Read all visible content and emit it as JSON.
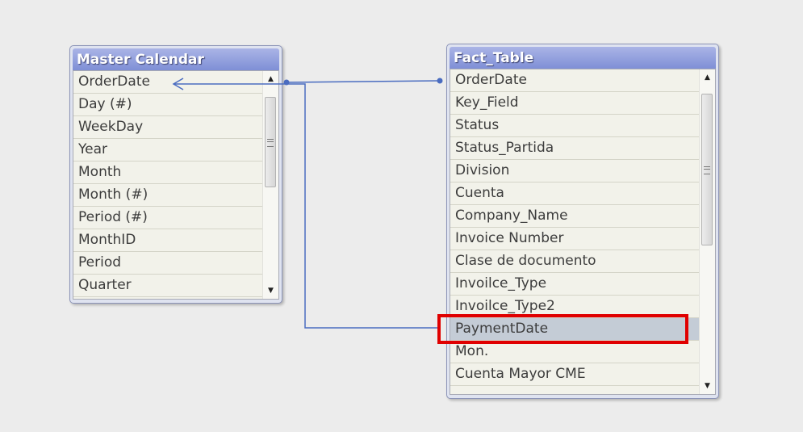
{
  "tables": [
    {
      "title": "Master Calendar",
      "fields": [
        "OrderDate",
        "Day (#)",
        "WeekDay",
        "Year",
        "Month",
        "Month (#)",
        "Period (#)",
        "MonthID",
        "Period",
        "Quarter"
      ],
      "scroll": {
        "up_icon": "scroll-up-arrow",
        "down_icon": "scroll-down-arrow"
      }
    },
    {
      "title": "Fact_Table",
      "fields": [
        "OrderDate",
        "Key_Field",
        "Status",
        "Status_Partida",
        "Division",
        "Cuenta",
        "Company_Name",
        "Invoice Number",
        "Clase de documento",
        "Invoilce_Type",
        "Invoilce_Type2",
        "PaymentDate",
        "Mon.",
        "Cuenta Mayor CME"
      ],
      "selected_field": "PaymentDate",
      "scroll": {
        "up_icon": "scroll-up-arrow",
        "down_icon": "scroll-down-arrow"
      }
    }
  ],
  "links": [
    {
      "from_table": "Fact_Table",
      "from_field": "OrderDate",
      "to_table": "Master Calendar",
      "to_field": "OrderDate"
    },
    {
      "from_table": "Fact_Table",
      "from_field": "PaymentDate",
      "to_table": "Master Calendar",
      "to_field": "OrderDate"
    }
  ],
  "colors": {
    "title_bar": "#8f9ddc",
    "link_line": "#4a6cc0",
    "highlight": "#e00000",
    "selected_row": "#c4ccd6"
  }
}
